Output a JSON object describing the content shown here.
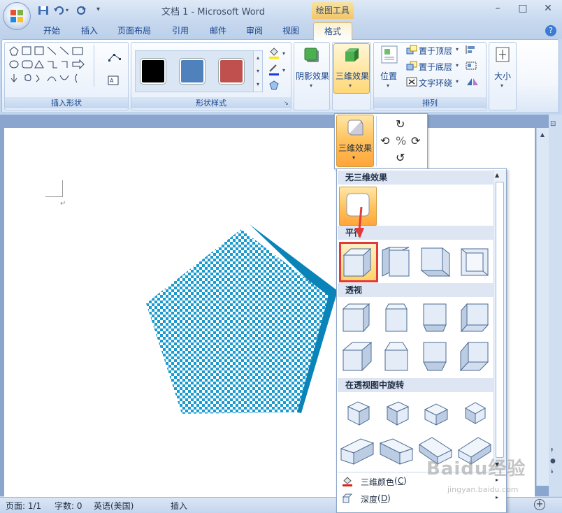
{
  "window": {
    "title": "文档 1 - Microsoft Word",
    "contextual_tab_group": "绘图工具",
    "minimize": "–",
    "maximize": "□",
    "close": "✕"
  },
  "tabs": [
    "开始",
    "插入",
    "页面布局",
    "引用",
    "邮件",
    "审阅",
    "视图",
    "格式"
  ],
  "ribbon": {
    "groups": {
      "insert_shapes": "插入形状",
      "shape_styles": "形状样式",
      "arrange": "排列"
    },
    "shadow_effects": "阴影效果",
    "three_d_effects": "三维效果",
    "position": "位置",
    "bring_to_front": "置于顶层",
    "send_to_back": "置于底层",
    "text_wrapping": "文字环绕",
    "size": "大小",
    "swatch_colors": [
      "#000000",
      "#4f81bd",
      "#c0504d"
    ]
  },
  "rotation_panel": {
    "three_d_button": "三维效果"
  },
  "gallery": {
    "sections": [
      "无三维效果",
      "平行",
      "透视",
      "在透视图中旋转"
    ],
    "menu_items": [
      {
        "label": "三维颜色",
        "shortcut": "C"
      },
      {
        "label": "深度",
        "shortcut": "D"
      }
    ]
  },
  "status": {
    "page": "页面: 1/1",
    "words": "字数: 0",
    "language": "英语(美国)",
    "mode": "插入"
  },
  "watermark": {
    "logo": "Baidu经验",
    "url": "jingyan.baidu.com"
  },
  "colors": {
    "accent": "#f2c66a",
    "shape_fill": "#1a8fc8",
    "highlight": "#e23a3a"
  }
}
